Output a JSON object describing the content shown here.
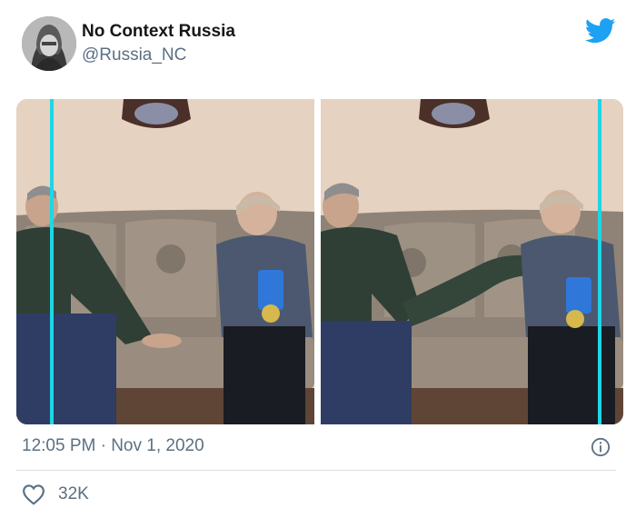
{
  "author": {
    "display_name": "No Context Russia",
    "handle": "@Russia_NC",
    "avatar_icon": "avatar-photo"
  },
  "brand": {
    "logo_icon": "twitter-bird-icon",
    "color": "#1da1f2"
  },
  "tweet": {
    "timestamp": "12:05 PM · Nov 1, 2020",
    "likes": "32K"
  },
  "icons": {
    "info": "info-icon",
    "like": "heart-icon"
  },
  "colors": {
    "text_primary": "#14171a",
    "text_secondary": "#5b7083",
    "divider": "#d9dee2",
    "overlay_line": "#1ed6e6"
  }
}
